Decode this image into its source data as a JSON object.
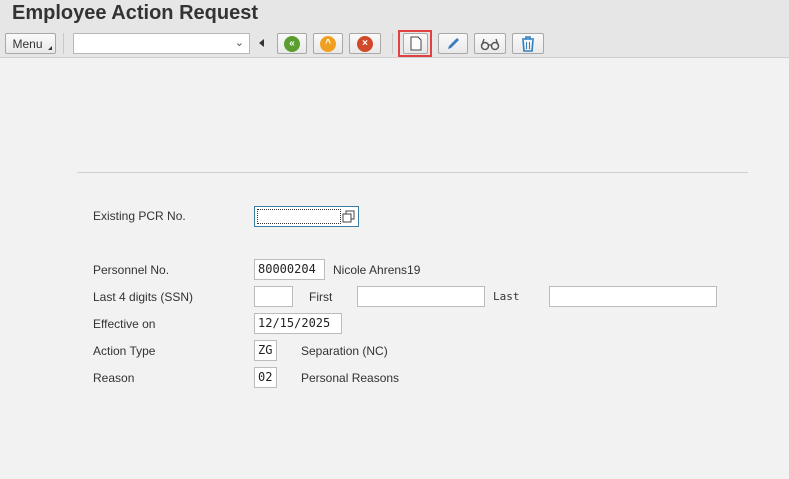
{
  "header": {
    "title": "Employee Action Request"
  },
  "toolbar": {
    "menu_label": "Menu",
    "dropdown_value": "",
    "dropdown_icon": "chevron-down-icon",
    "buttons": [
      {
        "icon": "back-icon",
        "color": "#5a9e2f"
      },
      {
        "icon": "exit-icon",
        "color": "#f0a020"
      },
      {
        "icon": "cancel-icon",
        "color": "#d04a2a"
      },
      {
        "icon": "new-document-icon"
      },
      {
        "icon": "pencil-icon",
        "color": "#3a7cc0"
      },
      {
        "icon": "glasses-icon"
      },
      {
        "icon": "trash-icon",
        "color": "#2f7fc1"
      }
    ]
  },
  "form": {
    "existing_pcr": {
      "label": "Existing PCR No.",
      "value": ""
    },
    "personnel": {
      "label": "Personnel No.",
      "value": "80000204",
      "name": "Nicole Ahrens19"
    },
    "ssn": {
      "label": "Last 4 digits (SSN)",
      "value": "",
      "first_label": "First",
      "first_value": "",
      "last_label": "Last",
      "last_value": ""
    },
    "effective": {
      "label": "Effective on",
      "value": "12/15/2025"
    },
    "action_type": {
      "label": "Action Type",
      "value": "ZG",
      "text": "Separation (NC)"
    },
    "reason": {
      "label": "Reason",
      "value": "02",
      "text": "Personal Reasons"
    }
  }
}
